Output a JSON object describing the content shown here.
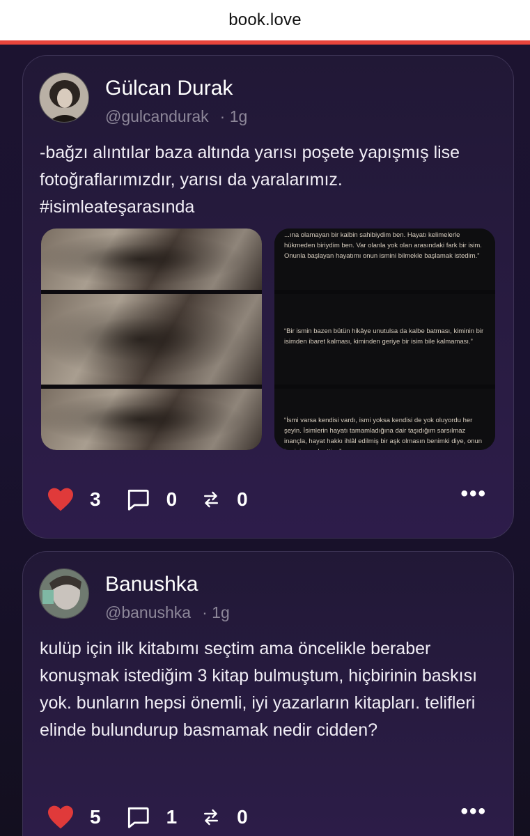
{
  "browser": {
    "url": "book.love"
  },
  "posts": [
    {
      "author": "Gülcan Durak",
      "handle": "@gulcandurak",
      "time": "· 1g",
      "text": "-bağzı alıntılar baza altında yarısı poşete yapışmış lise fotoğraflarımızdır, yarısı da yaralarımız. #isimleateşarasında",
      "quotes": [
        "...ına olamayan bir kalbin sahibiydim ben. Hayatı kelimelerle hükmeden biriydim ben. Var olanla yok olan arasındaki fark bir isim. Onunla başlayan hayatımı onun ismini bilmekle başlamak istedim.”",
        "“Bir ismin bazen bütün hikâye unutulsa da kalbe batması, kiminin bir isimden ibaret kalması, kiminden geriye bir isim bile kalmaması.”",
        "“İsmi varsa kendisi vardı, ismi yoksa kendisi de yok oluyordu her şeyin. İsimlerin hayatı tamamladığına dair taşıdığım sarsılmaz inançla, hayat hakkı ihlâl edilmiş bir aşk olmasın benimki diye, onun ismini merak ettim.”"
      ],
      "likes": "3",
      "comments": "0",
      "reposts": "0"
    },
    {
      "author": "Banushka",
      "handle": "@banushka",
      "time": "· 1g",
      "text": "kulüp için ilk kitabımı seçtim ama öncelikle beraber konuşmak istediğim 3 kitap bulmuştum, hiçbirinin baskısı yok. bunların hepsi önemli, iyi yazarların kitapları. telifleri elinde bulundurup basmamak nedir cidden?",
      "likes": "5",
      "comments": "1",
      "reposts": "0"
    }
  ],
  "colors": {
    "heart": "#e03a3a",
    "accent_line": "#e8453c",
    "card_bg": "#241a3a"
  },
  "icons": [
    "heart-icon",
    "comment-icon",
    "repost-icon",
    "more-icon"
  ]
}
